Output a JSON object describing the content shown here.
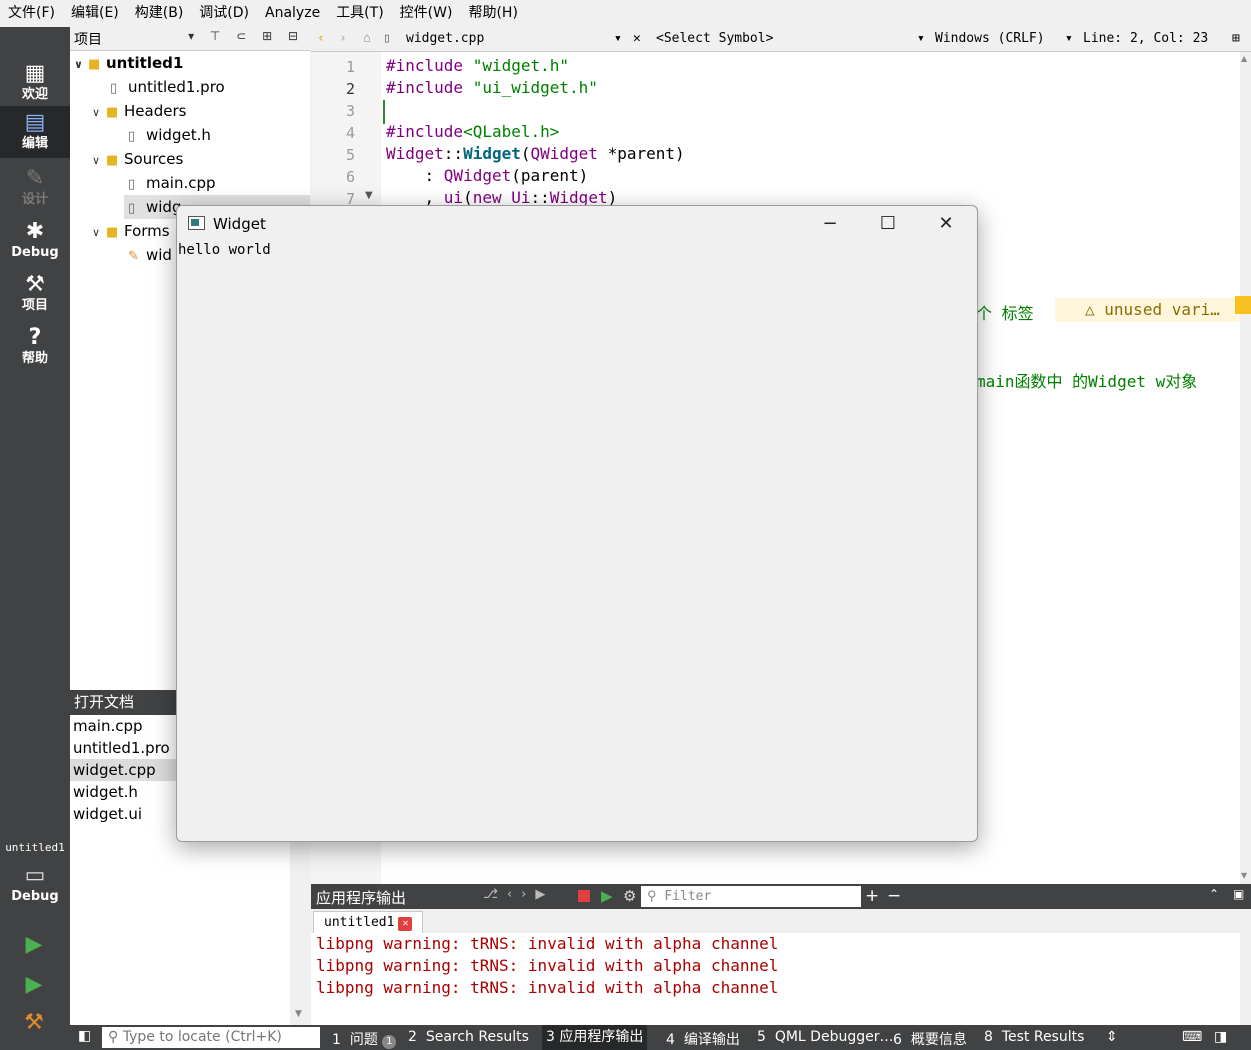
{
  "menu": [
    "文件(F)",
    "编辑(E)",
    "构建(B)",
    "调试(D)",
    "Analyze",
    "工具(T)",
    "控件(W)",
    "帮助(H)"
  ],
  "modes": [
    {
      "label": "欢迎",
      "icon": "grid-icon"
    },
    {
      "label": "编辑",
      "icon": "edit-icon"
    },
    {
      "label": "设计",
      "icon": "pencil-icon"
    },
    {
      "label": "Debug",
      "icon": "bug-icon"
    },
    {
      "label": "项目",
      "icon": "wrench-icon"
    },
    {
      "label": "帮助",
      "icon": "help-icon"
    }
  ],
  "kit": {
    "project": "untitled1",
    "config": "Debug"
  },
  "project_panel": {
    "title": "项目",
    "tree": {
      "root": "untitled1",
      "pro": "untitled1.pro",
      "headers": "Headers",
      "header_file": "widget.h",
      "sources": "Sources",
      "main_cpp": "main.cpp",
      "widget_cpp": "widg",
      "forms": "Forms",
      "form_file": "wid"
    }
  },
  "open_docs": {
    "title": "打开文档",
    "items": [
      "main.cpp",
      "untitled1.pro",
      "widget.cpp",
      "widget.h",
      "widget.ui"
    ]
  },
  "editor_toolbar": {
    "file": "widget.cpp",
    "symbol": "<Select Symbol>",
    "line_ending": "Windows (CRLF)",
    "position": "Line: 2, Col: 23"
  },
  "editor": {
    "line_numbers": [
      "1",
      "2",
      "3",
      "4",
      "5",
      "6",
      "7"
    ],
    "lines": {
      "l1_kw": "#include",
      "l1_str": "\"widget.h\"",
      "l2_kw": "#include",
      "l2_str": "\"ui_widget.h\"",
      "l4_kw": "#include",
      "l4_str": "<QLabel.h>",
      "l5_cls": "Widget",
      "l5_sep": "::",
      "l5_fn": "Widget",
      "l5_open": "(",
      "l5_param_type": "QWidget",
      "l5_param": " *parent)",
      "l6_pre": "    : ",
      "l6_cls": "QWidget",
      "l6_post": "(parent)",
      "l7_pre": "    , ",
      "l7_member": "ui",
      "l7_open": "(",
      "l7_kw": "new",
      "l7_cls": " Ui",
      "l7_sep": "::",
      "l7_cls2": "Widget",
      "l7_close": ")"
    },
    "comment_1": "个 标签",
    "warning": "unused vari…",
    "comment_2": "main函数中 的Widget w对象"
  },
  "output": {
    "title": "应用程序输出",
    "filter_placeholder": "Filter",
    "tab": "untitled1",
    "lines": [
      "libpng warning: tRNS: invalid with alpha channel",
      "libpng warning: tRNS: invalid with alpha channel",
      "libpng warning: tRNS: invalid with alpha channel"
    ]
  },
  "statusbar": {
    "locator_placeholder": "Type to locate (Ctrl+K)",
    "tabs": [
      {
        "num": "1",
        "label": "问题"
      },
      {
        "num": "2",
        "label": "Search Results"
      },
      {
        "num": "3",
        "label": "应用程序输出"
      },
      {
        "num": "4",
        "label": "编译输出"
      },
      {
        "num": "5",
        "label": "QML Debugger…"
      },
      {
        "num": "6",
        "label": "概要信息"
      },
      {
        "num": "8",
        "label": "Test Results"
      }
    ],
    "issues_count": "1"
  },
  "popup": {
    "title": "Widget",
    "label": "hello world"
  },
  "colors": {
    "sidebar": "#404244",
    "active_mode": "#262829",
    "warning_text": "#aa0000",
    "keyword": "#800080",
    "string": "#008000"
  }
}
